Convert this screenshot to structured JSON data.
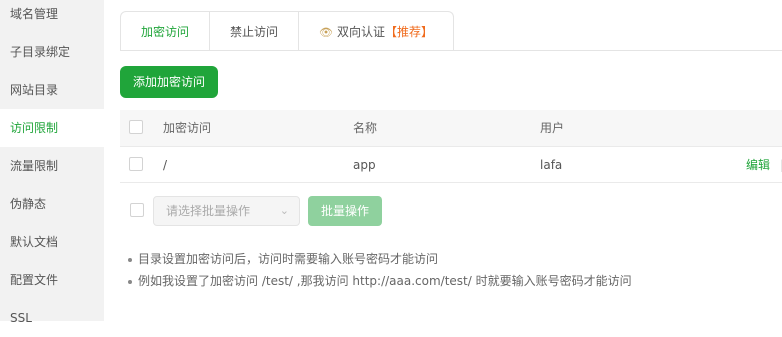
{
  "sidebar": {
    "items": [
      {
        "label": "域名管理",
        "active": false
      },
      {
        "label": "子目录绑定",
        "active": false
      },
      {
        "label": "网站目录",
        "active": false
      },
      {
        "label": "访问限制",
        "active": true
      },
      {
        "label": "流量限制",
        "active": false
      },
      {
        "label": "伪静态",
        "active": false
      },
      {
        "label": "默认文档",
        "active": false
      },
      {
        "label": "配置文件",
        "active": false
      },
      {
        "label": "SSL",
        "active": false
      }
    ]
  },
  "tabs": [
    {
      "label": "加密访问",
      "active": true
    },
    {
      "label": "禁止访问",
      "active": false
    },
    {
      "label": "双向认证",
      "badge": "【推荐】",
      "active": false
    }
  ],
  "toolbar": {
    "add_label": "添加加密访问"
  },
  "table": {
    "headers": [
      "加密访问",
      "名称",
      "用户"
    ],
    "rows": [
      {
        "path": "/",
        "name": "app",
        "user": "lafa",
        "action": "编辑"
      }
    ]
  },
  "batch": {
    "placeholder": "请选择批量操作",
    "button": "批量操作"
  },
  "tips": [
    "目录设置加密访问后，访问时需要输入账号密码才能访问",
    "例如我设置了加密访问 /test/ ,那我访问 http://aaa.com/test/ 时就要输入账号密码才能访问"
  ],
  "colors": {
    "accent": "#20a53a",
    "recommend": "#f06b1d",
    "sidebar_bg": "#f2f2f2"
  }
}
